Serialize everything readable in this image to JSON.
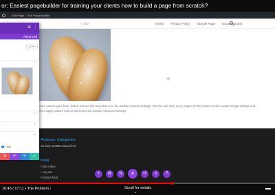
{
  "video": {
    "title": "or: Easiest pagebuilder for training your clients how to build a page from scratch?"
  },
  "adminbar": {
    "items": [
      "",
      "Edit Page",
      "Exit Visual Builder"
    ]
  },
  "site": {
    "nav": [
      "Home",
      "Privacy Policy",
      "Sample Page",
      "Uncategorized"
    ],
    "body_text": "Your content goes here. Edit or remove this text inline or in the module Content settings. You can also style every aspect of this content in the module Design settings and even apply custom CSS to this text in the module Advanced settings."
  },
  "footer": {
    "archives_heading": "Archives",
    "archives_item": "January 2019",
    "categories_heading": "Categories",
    "categories_item": "Uncategorized",
    "meta_heading": "Meta",
    "meta_items": [
      "Site Admin",
      "Log out",
      "Entries feed"
    ]
  },
  "builder_bar": {
    "icons": [
      "add-icon",
      "settings-icon",
      "portability-icon",
      "close-icon",
      "history-icon",
      "layers-icon",
      "help-icon"
    ],
    "center": "×"
  },
  "panel": {
    "tab": "Advanced",
    "filter": "+ Filter",
    "help": "Help",
    "colors": {
      "header": "#6c2eb9",
      "cancel": "#ef5555",
      "undo": "#8c47e0",
      "redo": "#2b87da",
      "save": "#29c4a9"
    }
  },
  "player": {
    "time": "10:46 / 17:11 • The Problem ›",
    "scroll_label": "Scroll for details",
    "progress": 0.627,
    "accent": "#ff0000"
  }
}
